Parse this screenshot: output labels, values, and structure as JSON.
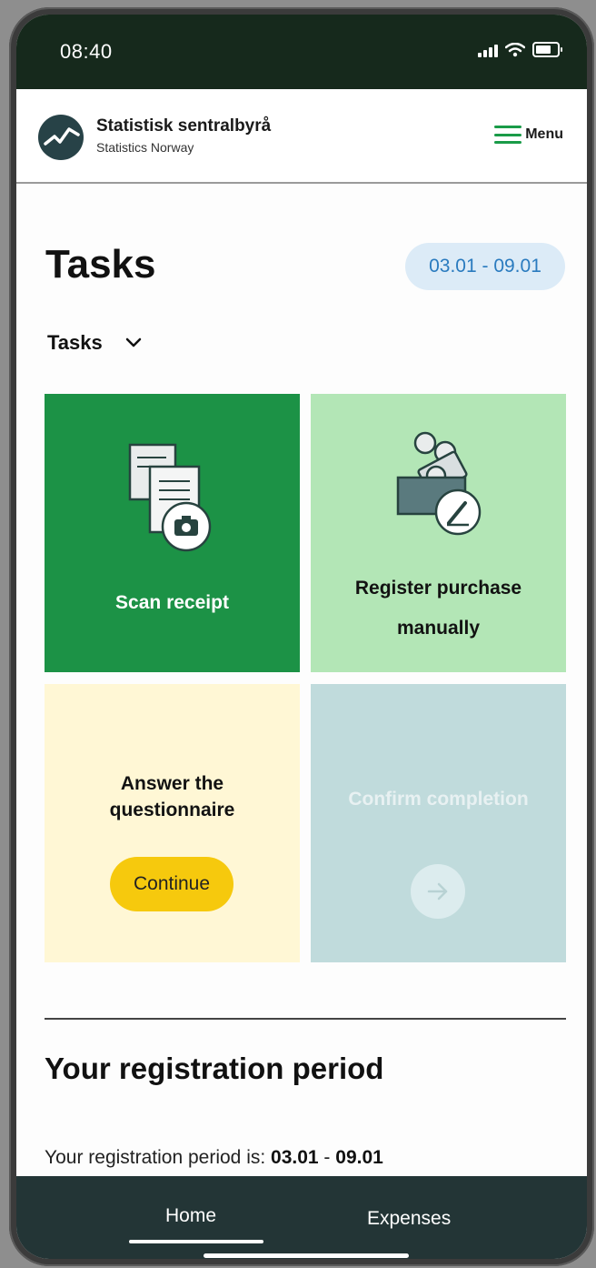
{
  "status_bar": {
    "time": "08:40"
  },
  "header": {
    "brand_name": "Statistisk sentralbyrå",
    "brand_sub": "Statistics Norway",
    "menu_label": "Menu"
  },
  "page": {
    "title": "Tasks",
    "date_range": "03.01 - 09.01",
    "tasks_dropdown": "Tasks"
  },
  "tiles": {
    "scan": {
      "label": "Scan receipt"
    },
    "register": {
      "label": "Register purchase manually"
    },
    "questionnaire": {
      "label": "Answer the questionnaire",
      "button": "Continue"
    },
    "confirm": {
      "label": "Confirm completion"
    }
  },
  "registration": {
    "title": "Your registration period",
    "text_prefix": "Your registration period is: ",
    "start": "03.01",
    "separator": " - ",
    "end": "09.01"
  },
  "bottom_nav": {
    "home": "Home",
    "expenses": "Expenses",
    "active": "Home"
  },
  "colors": {
    "scan_tile": "#1c9246",
    "register_tile": "#b3e6b6",
    "questionnaire_tile": "#fff7d5",
    "confirm_tile": "#c0dbdc",
    "continue_button": "#f6c90d",
    "date_pill": "#dcebf7",
    "bottom_nav": "#233536"
  }
}
